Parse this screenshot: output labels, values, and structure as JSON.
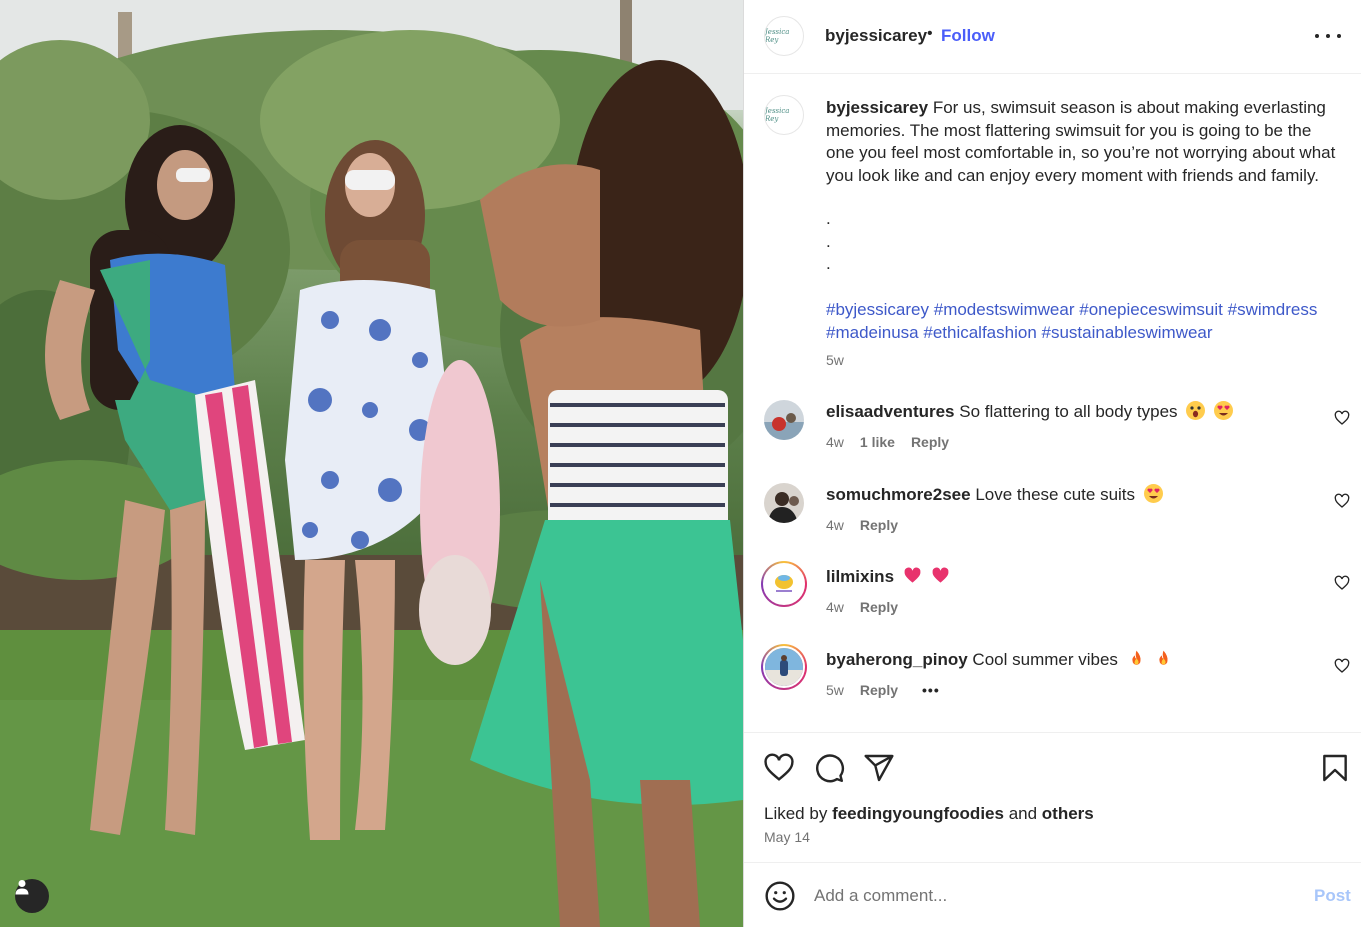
{
  "post": {
    "author": "byjessicarey",
    "logo_text": "Jessica Rey",
    "separator": "•",
    "follow_label": "Follow",
    "more_icon": "more-horizontal-icon",
    "caption": "For us, swimsuit season is about making everlasting memories. The most flattering swimsuit for you is going to be the one you feel most comfortable in, so you’re not worrying about what you look like and can enjoy every moment with friends and family.",
    "caption_dots": [
      ".",
      ".",
      "."
    ],
    "hashtags": [
      "#byjessicarey",
      "#modestswimwear",
      "#onepieceswimsuit",
      "#swimdress",
      "#madeinusa",
      "#ethicalfashion",
      "#sustainableswimwear"
    ],
    "caption_time": "5w"
  },
  "comments": [
    {
      "user": "elisaadventures",
      "text": "So flattering to all body types",
      "emojis": [
        "😱",
        "😍"
      ],
      "time": "4w",
      "likes": "1 like",
      "reply": "Reply"
    },
    {
      "user": "somuchmore2see",
      "text": "Love these cute suits",
      "emojis": [
        "😍"
      ],
      "time": "4w",
      "reply": "Reply"
    },
    {
      "user": "lilmixins",
      "text": "",
      "emojis": [
        "💗",
        "💗"
      ],
      "time": "4w",
      "reply": "Reply"
    },
    {
      "user": "byaherong_pinoy",
      "text": "Cool summer vibes",
      "emojis": [
        "🔥",
        "🔥"
      ],
      "time": "5w",
      "reply": "Reply",
      "more": "•••"
    }
  ],
  "actions": {
    "like_icon": "heart-icon",
    "comment_icon": "comment-icon",
    "share_icon": "paper-plane-icon",
    "save_icon": "bookmark-icon"
  },
  "likes": {
    "prefix": "Liked by",
    "user": "feedingyoungfoodies",
    "and": "and",
    "others": "others"
  },
  "date": "May 14",
  "comment_box": {
    "emoji_icon": "smiley-icon",
    "placeholder": "Add a comment...",
    "post_label": "Post"
  },
  "colors": {
    "follow": "#4a5df9",
    "hashtag": "#3e59c9",
    "post_disabled": "#a8c6fa",
    "muted": "#737373"
  }
}
